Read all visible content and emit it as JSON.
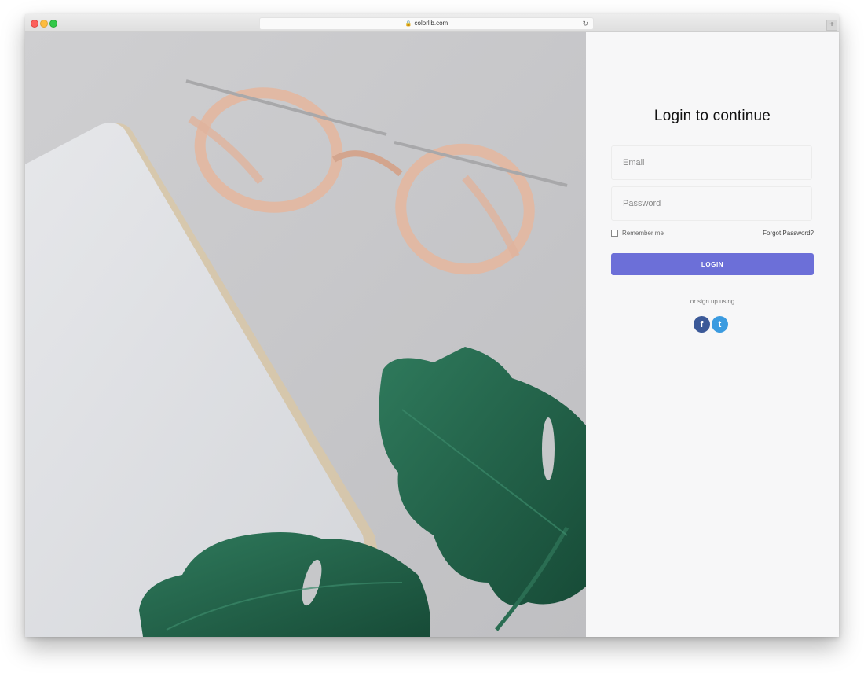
{
  "browser": {
    "url": "colorlib.com",
    "new_tab_label": "+"
  },
  "login": {
    "title": "Login to continue",
    "email_placeholder": "Email",
    "password_placeholder": "Password",
    "remember_label": "Remember me",
    "forgot_label": "Forgot Password?",
    "button_label": "LOGIN",
    "signup_text": "or sign up using",
    "social": [
      {
        "name": "facebook-icon",
        "glyph": "f",
        "color": "#3b5998"
      },
      {
        "name": "twitter-icon",
        "glyph": "t",
        "color": "#3b9be0"
      }
    ]
  },
  "colors": {
    "accent": "#6c6fd8",
    "panel_bg": "#f7f7f8",
    "photo_bg": "#c9c9cc"
  }
}
